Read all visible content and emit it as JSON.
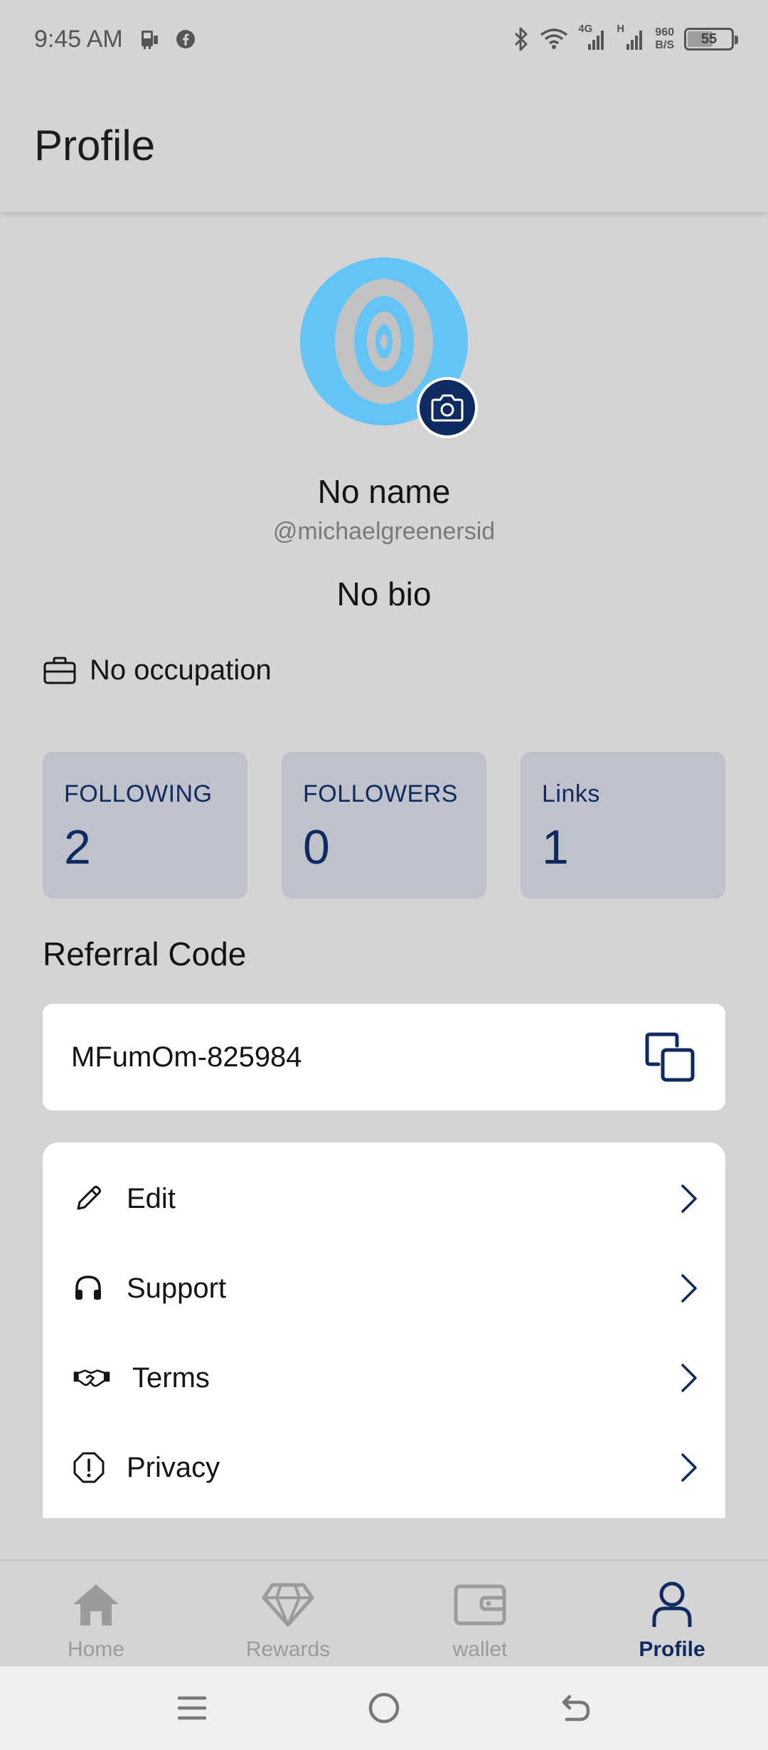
{
  "status_bar": {
    "time": "9:45 AM",
    "net_speed_value": "960",
    "net_speed_unit": "B/S",
    "network_4g": "4G",
    "network_h": "H",
    "battery_level": "55"
  },
  "header": {
    "title": "Profile"
  },
  "profile": {
    "name": "No name",
    "handle": "@michaelgreenersid",
    "bio": "No bio",
    "occupation": "No occupation"
  },
  "stats": [
    {
      "label": "FOLLOWING",
      "value": "2"
    },
    {
      "label": "FOLLOWERS",
      "value": "0"
    },
    {
      "label": "Links",
      "value": "1"
    }
  ],
  "referral": {
    "title": "Referral Code",
    "code": "MFumOm-825984"
  },
  "menu": {
    "items": [
      {
        "label": "Edit",
        "icon": "pencil-icon"
      },
      {
        "label": "Support",
        "icon": "headset-icon"
      },
      {
        "label": "Terms",
        "icon": "handshake-icon"
      },
      {
        "label": "Privacy",
        "icon": "alert-octagon-icon"
      }
    ]
  },
  "bottom_nav": {
    "items": [
      {
        "label": "Home",
        "icon": "home-icon",
        "active": false
      },
      {
        "label": "Rewards",
        "icon": "diamond-icon",
        "active": false
      },
      {
        "label": "wallet",
        "icon": "wallet-icon",
        "active": false
      },
      {
        "label": "Profile",
        "icon": "person-icon",
        "active": true
      }
    ]
  },
  "colors": {
    "background": "#d4d4d4",
    "accent_navy": "#0f2a5f",
    "avatar_blue": "#64c4f6",
    "stat_card": "#c0c2cb",
    "inactive_nav": "#9b9b9b"
  }
}
